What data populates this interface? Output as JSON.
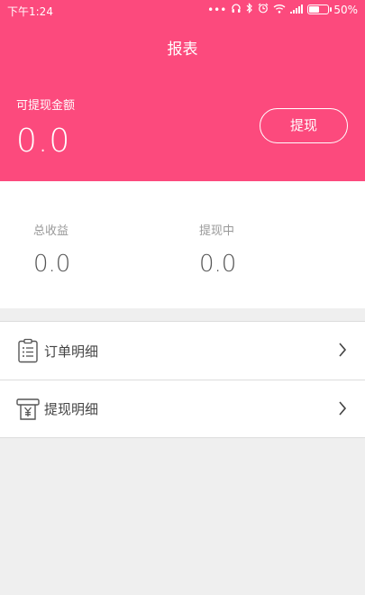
{
  "status_bar": {
    "time": "下午1:24",
    "icons": [
      "more-dots-icon",
      "headphones-icon",
      "bluetooth-icon",
      "alarm-icon",
      "wifi-icon",
      "signal-icon",
      "battery-icon"
    ],
    "battery_percent": "50%",
    "battery_level": 0.5
  },
  "header": {
    "title": "报表",
    "available_label": "可提现金额",
    "available_value": "0.0",
    "withdraw_button": "提现",
    "background_color": "#fc4a7d"
  },
  "stats": {
    "total_label": "总收益",
    "total_value": "0.0",
    "pending_label": "提现中",
    "pending_value": "0.0"
  },
  "menu": {
    "items": [
      {
        "label": "订单明细",
        "icon": "clipboard-list-icon"
      },
      {
        "label": "提现明细",
        "icon": "yen-withdraw-icon"
      }
    ]
  }
}
